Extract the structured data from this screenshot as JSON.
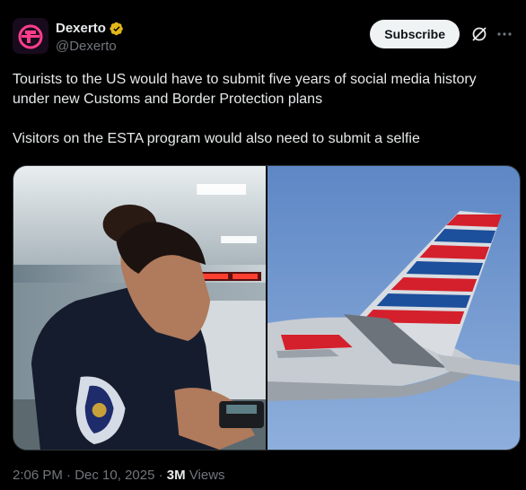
{
  "author": {
    "display_name": "Dexerto",
    "handle": "@Dexerto",
    "verified_icon": "verified-badge-gold"
  },
  "actions": {
    "subscribe_label": "Subscribe",
    "grok_icon": "grok-icon",
    "more_icon": "more-icon"
  },
  "tweet": {
    "paragraph_1": "Tourists to the US would have to submit five years of social media history under new Customs and Border Protection plans",
    "paragraph_2": "Visitors on the ESTA program would also need to submit a selfie"
  },
  "media": {
    "left_image": "border-officer-photo",
    "right_image": "airplane-tail-photo"
  },
  "meta": {
    "time": "2:06 PM",
    "separator": "·",
    "date": "Dec 10, 2025",
    "views_count": "3M",
    "views_label": "Views"
  },
  "colors": {
    "background": "#000000",
    "text": "#e7e9ea",
    "muted": "#71767b",
    "verified": "#e2b719",
    "subscribe_bg": "#eff3f4"
  }
}
